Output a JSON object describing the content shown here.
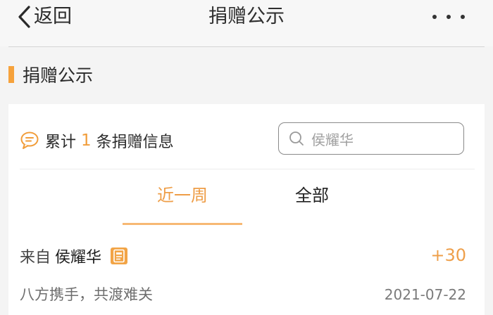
{
  "navbar": {
    "back_label": "返回",
    "back_icon": "chevron-left-icon",
    "title": "捐赠公示",
    "more_icon": "more-dots-icon"
  },
  "section": {
    "heading": "捐赠公示",
    "accent_color": "#f6a23c"
  },
  "summary": {
    "icon": "message-icon",
    "prefix": "累计",
    "count": "1",
    "suffix": "条捐赠信息"
  },
  "search": {
    "icon": "search-icon",
    "value": "侯耀华"
  },
  "tabs": [
    {
      "label": "近一周",
      "active": true
    },
    {
      "label": "全部",
      "active": false
    }
  ],
  "donations": [
    {
      "source_prefix": "来自",
      "donor": "侯耀华",
      "badge_icon": "donor-badge-icon",
      "amount": "+30",
      "message": "八方携手，共渡难关",
      "date": "2021-07-22"
    }
  ],
  "colors": {
    "accent": "#f19d3a",
    "tab_active": "#ee9d46",
    "background": "#f4f4f4"
  }
}
